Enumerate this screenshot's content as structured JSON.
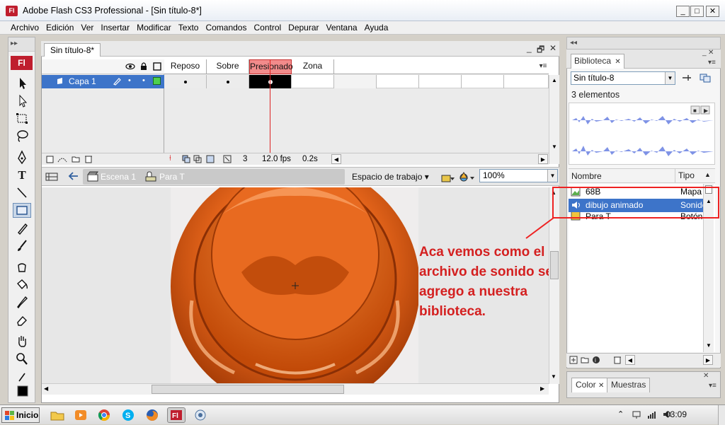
{
  "window": {
    "app_badge": "Fl",
    "title": "Adobe Flash CS3 Professional - [Sin título-8*]",
    "minimize": "_",
    "maximize": "□",
    "close": "✕"
  },
  "menu": [
    "Archivo",
    "Edición",
    "Ver",
    "Insertar",
    "Modificar",
    "Texto",
    "Comandos",
    "Control",
    "Depurar",
    "Ventana",
    "Ayuda"
  ],
  "toolbar": {
    "badge": "Fl",
    "grip": "▸▸",
    "tools": [
      "arrow-icon",
      "subselect-icon",
      "free-transform-icon",
      "lasso-icon",
      "pen-icon",
      "text-tool-icon",
      "line-icon",
      "rectangle-icon",
      "pencil-icon",
      "brush-icon",
      "ink-bottle-icon",
      "paint-bucket-icon",
      "eyedropper-icon",
      "eraser-icon",
      "hand-icon",
      "zoom-icon",
      "stroke-color-icon",
      "fill-color-icon"
    ],
    "text_tool_glyph": "T"
  },
  "document": {
    "tab": "Sin título-8*",
    "tab_controls": [
      "_",
      "🗗",
      "✕"
    ],
    "timeline": {
      "layer_name": "Capa 1",
      "frame_labels": [
        "Reposo",
        "Sobre",
        "Presionado",
        "Zona activa"
      ],
      "selected_frame": "Presionado",
      "footer": {
        "frame": "3",
        "fps": "12.0 fps",
        "time": "0.2s"
      }
    },
    "breadcrumb": {
      "scene": "Escena 1",
      "symbol": "Para T"
    },
    "workspace_label": "Espacio de trabajo ▾",
    "zoom": "100%"
  },
  "annotation": {
    "lines": [
      "Aca vemos como el",
      "archivo de sonido se",
      "agrego a nuestra",
      "biblioteca."
    ],
    "color": "#d42020"
  },
  "library": {
    "tab": "Biblioteca",
    "document_select": "Sin título-8",
    "count": "3 elementos",
    "columns": {
      "name": "Nombre",
      "type": "Tipo",
      "sort": "▲"
    },
    "items": [
      {
        "name": "68B",
        "type": "Mapa"
      },
      {
        "name": "dibujo animado",
        "type": "Sonido",
        "selected": true
      },
      {
        "name": "Para T",
        "type": "Botón"
      }
    ],
    "bottom_tabs": [
      "Color",
      "Muestras"
    ]
  },
  "taskbar": {
    "start": "Inicio",
    "clock": "03:09"
  },
  "colors": {
    "selection": "#3d74c9",
    "frame_selected": "#f28b8b",
    "playhead": "#dd2222",
    "flash_red": "#bf1e2e",
    "button_orange": "#e8641a"
  }
}
